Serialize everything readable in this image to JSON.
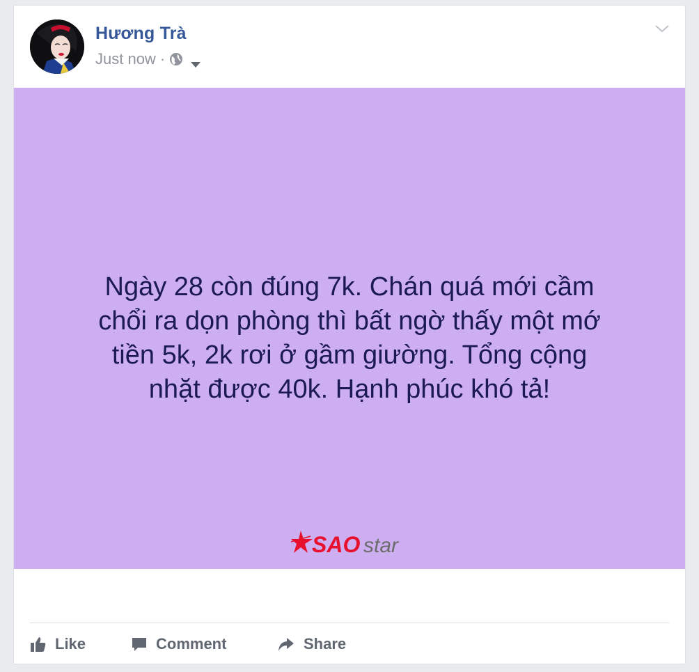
{
  "post": {
    "author": "Hương Trà",
    "timestamp": "Just now",
    "separator": "·",
    "privacy_icon": "globe-icon",
    "background_color": "#cdaef1",
    "text_lines": [
      "Ngày 28 còn đúng 7k. Chán quá mới cầm",
      "chổi ra dọn phòng thì bất ngờ thấy một mớ",
      "tiền 5k, 2k rơi ở gầm giường. Tổng cộng",
      "nhặt được 40k. Hạnh phúc khó tả!"
    ],
    "watermark": {
      "brand_red": "SAO",
      "brand_gray": "star"
    }
  },
  "actions": {
    "like_label": "Like",
    "comment_label": "Comment",
    "share_label": "Share"
  },
  "colors": {
    "author_link": "#365899",
    "post_text": "#1c1a55",
    "action_text": "#606770",
    "watermark_red": "#e8112d"
  }
}
